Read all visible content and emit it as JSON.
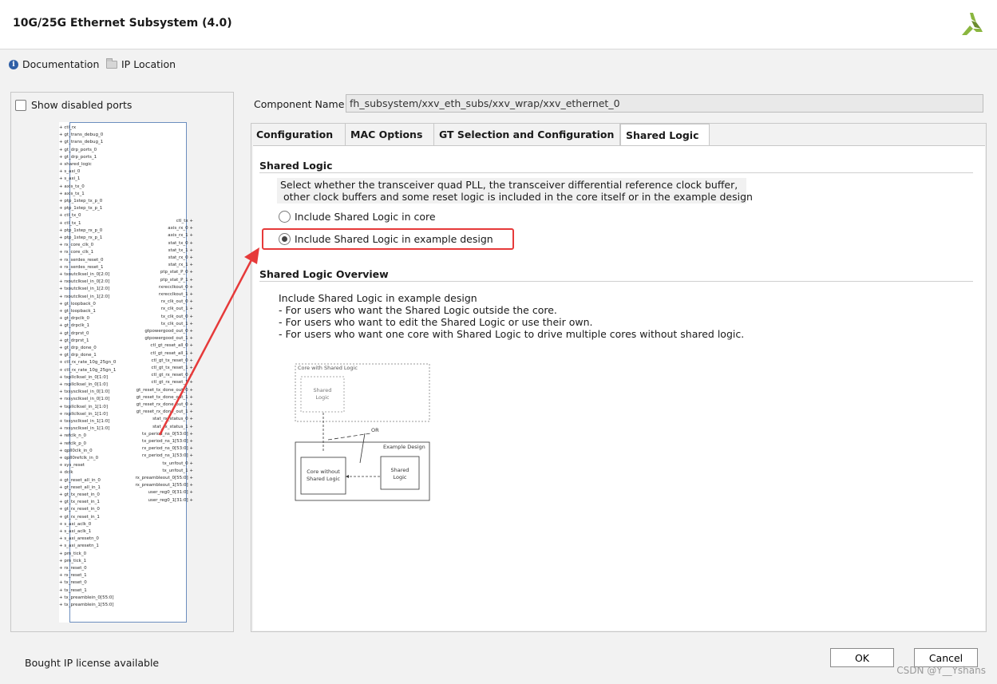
{
  "window": {
    "title": "10G/25G Ethernet Subsystem (4.0)"
  },
  "links": {
    "documentation": "Documentation",
    "ip_location": "IP Location"
  },
  "left_panel": {
    "show_disabled_ports": "Show disabled ports",
    "left_ports": [
      "ctl_rx",
      "gt_trans_debug_0",
      "gt_trans_debug_1",
      "gt_drp_ports_0",
      "gt_drp_ports_1",
      "shared_logic",
      "s_axi_0",
      "s_axi_1",
      "axis_tx_0",
      "axis_tx_1",
      "ptp_1step_tx_p_0",
      "ptp_1step_tx_p_1",
      "ctl_tx_0",
      "ctl_tx_1",
      "ptp_1step_rx_p_0",
      "ptp_1step_rx_p_1",
      "rx_core_clk_0",
      "rx_core_clk_1",
      "rx_serdes_reset_0",
      "rx_serdes_reset_1",
      "txoutclksel_in_0[2:0]",
      "rxoutclksel_in_0[2:0]",
      "txoutclksel_in_1[2:0]",
      "rxoutclksel_in_1[2:0]",
      "gt_loopback_0",
      "gt_loopback_1",
      "gt_drpclk_0",
      "gt_drpclk_1",
      "gt_drprst_0",
      "gt_drprst_1",
      "gt_drp_done_0",
      "gt_drp_done_1",
      "ctl_rx_rate_10g_25gn_0",
      "ctl_rx_rate_10g_25gn_1",
      "txpllclksel_in_0[1:0]",
      "rxpllclksel_in_0[1:0]",
      "txsysclksel_in_0[1:0]",
      "rxsysclksel_in_0[1:0]",
      "txpllclksel_in_1[1:0]",
      "rxpllclksel_in_1[1:0]",
      "txsysclksel_in_1[1:0]",
      "rxsysclksel_in_1[1:0]",
      "refclk_n_0",
      "refclk_p_0",
      "qpll0clk_in_0",
      "qpll0refclk_in_0",
      "sys_reset",
      "dclk",
      "gt_reset_all_in_0",
      "gt_reset_all_in_1",
      "gt_tx_reset_in_0",
      "gt_tx_reset_in_1",
      "gt_rx_reset_in_0",
      "gt_rx_reset_in_1",
      "s_axi_aclk_0",
      "s_axi_aclk_1",
      "s_axi_aresetn_0",
      "s_axi_aresetn_1",
      "pm_tick_0",
      "pm_tick_1",
      "rx_reset_0",
      "rx_reset_1",
      "tx_reset_0",
      "tx_reset_1",
      "tx_preamblein_0[55:0]",
      "tx_preamblein_1[55:0]"
    ],
    "right_ports": [
      "ctl_tx",
      "axis_rx_0",
      "axis_rx_1",
      "stat_tx_0",
      "stat_tx_1",
      "stat_rx_0",
      "stat_rx_1",
      "ptp_stat_P_0",
      "ptp_stat_P_1",
      "rxrecclkout_0",
      "rxrecclkout_1",
      "rx_clk_out_0",
      "rx_clk_out_1",
      "tx_clk_out_0",
      "tx_clk_out_1",
      "gtpowergood_out_0",
      "gtpowergood_out_1",
      "ctl_gt_reset_all_0",
      "ctl_gt_reset_all_1",
      "ctl_gt_tx_reset_0",
      "ctl_gt_tx_reset_1",
      "ctl_gt_rx_reset_0",
      "ctl_gt_rx_reset_1",
      "gt_reset_tx_done_out_0",
      "gt_reset_tx_done_out_1",
      "gt_reset_rx_done_out_0",
      "gt_reset_rx_done_out_1",
      "stat_rx_status_0",
      "stat_rx_status_1",
      "tx_period_ns_0[53:0]",
      "tx_period_ns_1[53:0]",
      "rx_period_ns_0[53:0]",
      "rx_period_ns_1[53:0]",
      "tx_unfout_0",
      "tx_unfout_1",
      "rx_preambleout_0[55:0]",
      "rx_preambleout_1[55:0]",
      "user_reg0_0[31:0]",
      "user_reg0_1[31:0]"
    ]
  },
  "component": {
    "label": "Component Name",
    "value": "fh_subsystem/xxv_eth_subs/xxv_wrap/xxv_ethernet_0"
  },
  "tabs": [
    "Configuration",
    "MAC Options",
    "GT Selection and Configuration",
    "Shared Logic"
  ],
  "shared_logic": {
    "title": "Shared Logic",
    "desc_line1": "Select whether the transceiver quad PLL, the transceiver differential reference clock buffer,",
    "desc_line2": " other clock buffers and some reset logic is included in the core itself or in the example design",
    "option_core": "Include Shared Logic in core",
    "option_example": "Include Shared Logic in example design",
    "selected": "Include Shared Logic in example design"
  },
  "overview": {
    "title": "Shared Logic Overview",
    "lines": [
      "Include Shared Logic in example design",
      "- For users who want the Shared Logic outside the core.",
      "- For users who want to edit the Shared Logic or use their own.",
      "- For users who want one core with Shared Logic to drive multiple cores without shared logic."
    ]
  },
  "diagram": {
    "core_with": "Core with Shared Logic",
    "shared_logic_a": "Shared",
    "shared_logic_b": "Logic",
    "or": "OR",
    "example_design": "Example Design",
    "core_without_a": "Core without",
    "core_without_b": "Shared Logic"
  },
  "status": {
    "license": "Bought IP license available"
  },
  "buttons": {
    "ok": "OK",
    "cancel": "Cancel"
  },
  "watermark": "CSDN @Y__Yshans",
  "colors": {
    "highlight": "#e63a3a",
    "logo_green": "#8ab63f",
    "logo_dark": "#6b8c2e"
  }
}
